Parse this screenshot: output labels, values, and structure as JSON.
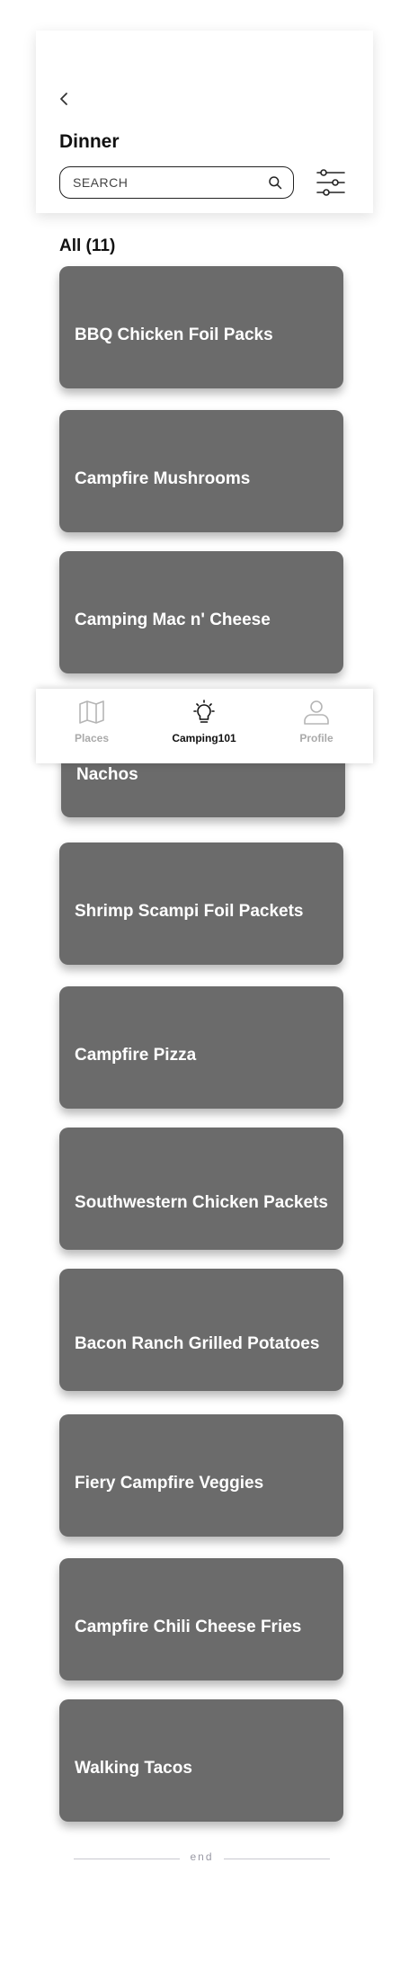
{
  "header": {
    "back_icon": "chevron-left-icon",
    "title": "Dinner",
    "search_placeholder": "SEARCH",
    "search_icon": "search-icon",
    "filter_icon": "sliders-icon"
  },
  "section": {
    "title": "All (11)"
  },
  "recipes": [
    "BBQ Chicken Foil Packs",
    "Campfire Mushrooms",
    "Camping Mac n' Cheese",
    "Chicken and Black Bean Nachos",
    "Shrimp Scampi Foil Packets",
    "Campfire Pizza",
    "Southwestern Chicken Packets",
    "Bacon Ranch Grilled Potatoes",
    "Fiery Campfire Veggies",
    "Campfire Chili Cheese Fries",
    "Walking Tacos"
  ],
  "bottom_nav": {
    "items": [
      {
        "label": "Places",
        "icon": "map-icon",
        "active": false
      },
      {
        "label": "Camping101",
        "icon": "lightbulb-icon",
        "active": true
      },
      {
        "label": "Profile",
        "icon": "user-icon",
        "active": false
      }
    ]
  },
  "footer": {
    "end_text": "end"
  },
  "colors": {
    "card": "#6b6b6b",
    "card_text": "#ffffff",
    "inactive_nav": "#aaaaaa",
    "divider": "#c8c8d0"
  }
}
